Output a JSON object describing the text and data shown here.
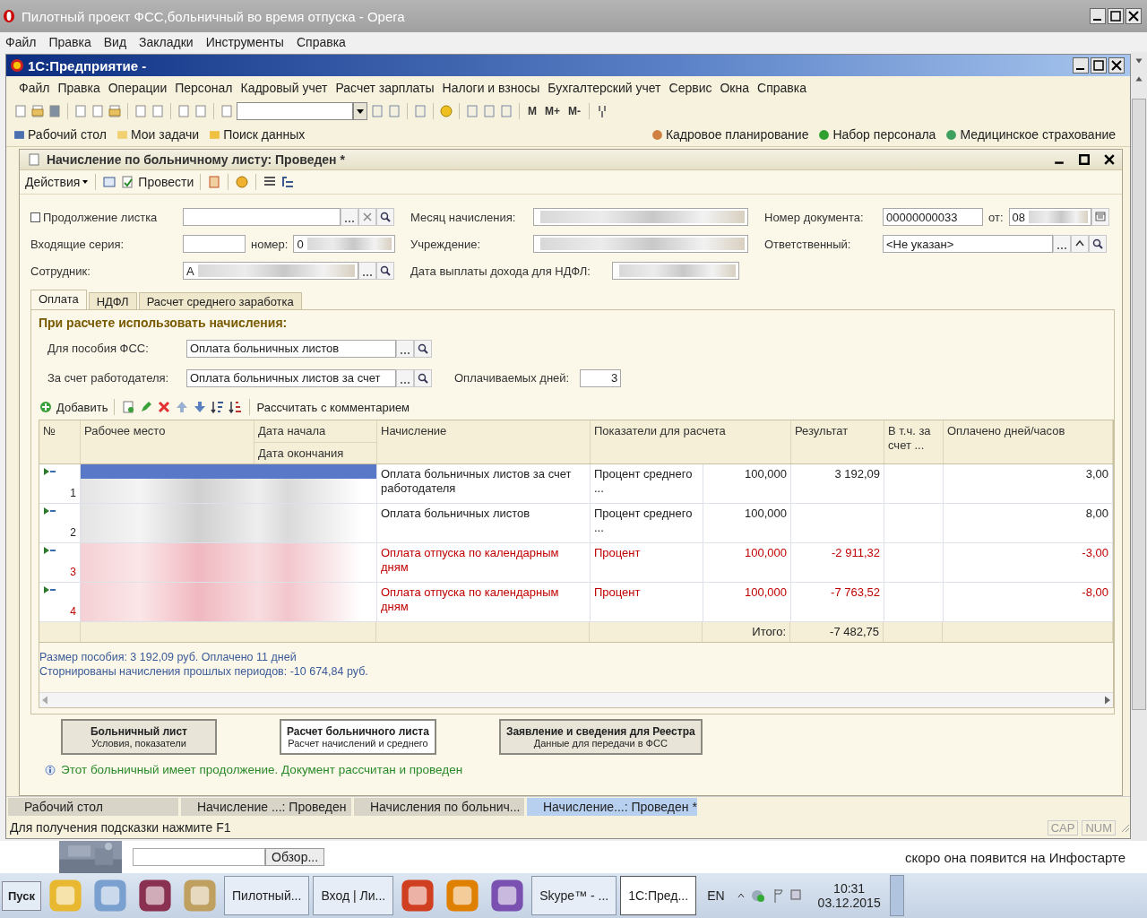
{
  "browser": {
    "title": "Пилотный проект ФСС,больничный во время отпуска - Opera",
    "menu": [
      "Файл",
      "Правка",
      "Вид",
      "Закладки",
      "Инструменты",
      "Справка"
    ]
  },
  "app": {
    "title": "1С:Предприятие -",
    "menu": [
      "Файл",
      "Правка",
      "Операции",
      "Персонал",
      "Кадровый учет",
      "Расчет зарплаты",
      "Налоги и взносы",
      "Бухгалтерский учет",
      "Сервис",
      "Окна",
      "Справка"
    ],
    "memory_buttons": [
      "M",
      "M+",
      "M-"
    ],
    "panel_left": [
      "Рабочий стол",
      "Мои задачи",
      "Поиск данных"
    ],
    "panel_right": [
      "Кадровое планирование",
      "Набор персонала",
      "Медицинское страхование"
    ]
  },
  "document": {
    "title": "Начисление по больничному листу: Проведен *",
    "actions": [
      "Действия",
      "Провести"
    ],
    "continuation": {
      "label": "Продолжение листка",
      "checked": false
    },
    "series": {
      "label": "Входящие серия:",
      "number_label": "номер:",
      "number_value": "0"
    },
    "employee": {
      "label": "Сотрудник:",
      "value": "А"
    },
    "month": {
      "label": "Месяц начисления:"
    },
    "institution": {
      "label": "Учреждение:"
    },
    "ndfl_date": {
      "label": "Дата выплаты дохода для НДФЛ:"
    },
    "doc_number": {
      "label": "Номер документа:",
      "value": "00000000033",
      "date_label": "от:",
      "date_value": "08"
    },
    "responsible": {
      "label": "Ответственный:",
      "value": "<Не указан>"
    },
    "tabs": [
      {
        "label": "Оплата",
        "selected": true
      },
      {
        "label": "НДФЛ",
        "selected": false
      },
      {
        "label": "Расчет среднего заработка",
        "selected": false
      }
    ],
    "section_title": "При расчете использовать начисления:",
    "fss": {
      "label": "Для пособия ФСС:",
      "value": "Оплата больничных листов"
    },
    "employer": {
      "label": "За счет работодателя:",
      "value": "Оплата больничных листов за счет"
    },
    "paid_days": {
      "label": "Оплачиваемых дней:",
      "value": "3"
    },
    "grid_toolbar": {
      "add": "Добавить",
      "calculate": "Рассчитать с комментарием"
    },
    "table": {
      "columns": [
        "№",
        "Рабочее место",
        "Дата начала",
        "Дата окончания",
        "Начисление",
        "Показатели для расчета",
        "Результат",
        "В т.ч. за счет ...",
        "Оплачено дней/часов"
      ],
      "rows": [
        {
          "number": "1",
          "accrual": "Оплата больничных листов за счет работодателя",
          "indicator": "Процент среднего ...",
          "rate": "100,000",
          "result": "3 192,09",
          "paid": "3,00",
          "storno": false,
          "selected": true
        },
        {
          "number": "2",
          "accrual": "Оплата больничных листов",
          "indicator": "Процент среднего ...",
          "rate": "100,000",
          "result": "",
          "paid": "8,00",
          "storno": false,
          "selected": false
        },
        {
          "number": "3",
          "accrual": "Оплата отпуска по календарным дням",
          "indicator": "Процент",
          "rate": "100,000",
          "result": "-2 911,32",
          "paid": "-3,00",
          "storno": true,
          "selected": false
        },
        {
          "number": "4",
          "accrual": "Оплата отпуска по календарным дням",
          "indicator": "Процент",
          "rate": "100,000",
          "result": "-7 763,52",
          "paid": "-8,00",
          "storno": true,
          "selected": false
        }
      ],
      "total_label": "Итого:",
      "total": "-7 482,75"
    },
    "summary": [
      "Размер пособия: 3 192,09 руб. Оплачено 11 дней",
      "Сторнированы начисления прошлых периодов: -10 674,84 руб."
    ],
    "big_buttons": [
      {
        "title": "Больничный лист",
        "subtitle": "Условия, показатели",
        "selected": false
      },
      {
        "title": "Расчет больничного листа",
        "subtitle": "Расчет начислений и среднего",
        "selected": true
      },
      {
        "title": "Заявление и сведения для Реестра",
        "subtitle": "Данные для передачи в ФСС",
        "selected": false
      }
    ],
    "info": "Этот больничный имеет продолжение. Документ рассчитан и проведен"
  },
  "window_tabs": [
    {
      "label": "Рабочий стол",
      "selected": false
    },
    {
      "label": "Начисление ...: Проведен",
      "selected": false
    },
    {
      "label": "Начисления по больнич...",
      "selected": false
    },
    {
      "label": "Начисление...: Проведен *",
      "selected": true
    }
  ],
  "status_bar": {
    "hint": "Для получения подсказки нажмите F1",
    "indicators": [
      "CAP",
      "NUM"
    ]
  },
  "page_behind": {
    "button": "Обзор...",
    "text": "скоро она появится на Инфостарте"
  },
  "taskbar": {
    "start": "Пуск",
    "items": [
      {
        "kind": "launcher"
      },
      {
        "kind": "launcher"
      },
      {
        "kind": "launcher"
      },
      {
        "kind": "launcher"
      },
      {
        "kind": "window",
        "label": "Пилотный...",
        "selected": false
      },
      {
        "kind": "window",
        "label": "Вход | Ли...",
        "selected": false
      },
      {
        "kind": "launcher"
      },
      {
        "kind": "launcher"
      },
      {
        "kind": "launcher"
      },
      {
        "kind": "window",
        "label": "Skype™ - ...",
        "selected": false
      },
      {
        "kind": "window",
        "label": "1С:Пред...",
        "selected": true
      }
    ],
    "language": "EN",
    "time": "10:31",
    "date": "03.12.2015"
  }
}
